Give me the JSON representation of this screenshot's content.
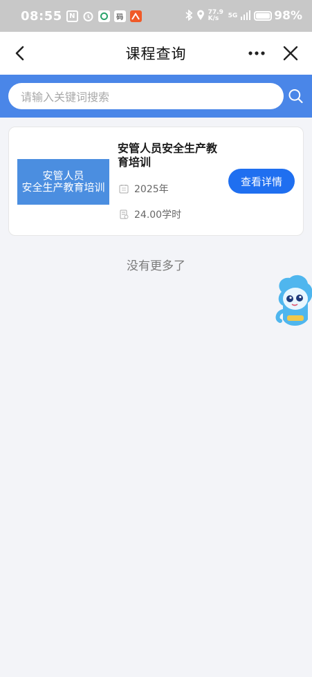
{
  "status_bar": {
    "time": "08:55",
    "net_speed": "77.9 K/s",
    "network": "5G",
    "battery": "98%"
  },
  "nav": {
    "title": "课程查询"
  },
  "search": {
    "placeholder": "请输入关键词搜索"
  },
  "course": {
    "thumb_line1": "安管人员",
    "thumb_line2": "安全生产教育培训",
    "title": "安管人员安全生产教育培训",
    "year": "2025年",
    "hours": "24.00学时",
    "detail_label": "查看详情"
  },
  "footer": {
    "no_more": "没有更多了"
  },
  "colors": {
    "accent": "#4a86e8",
    "button": "#1f6ff0",
    "thumb": "#4b8ee0"
  }
}
